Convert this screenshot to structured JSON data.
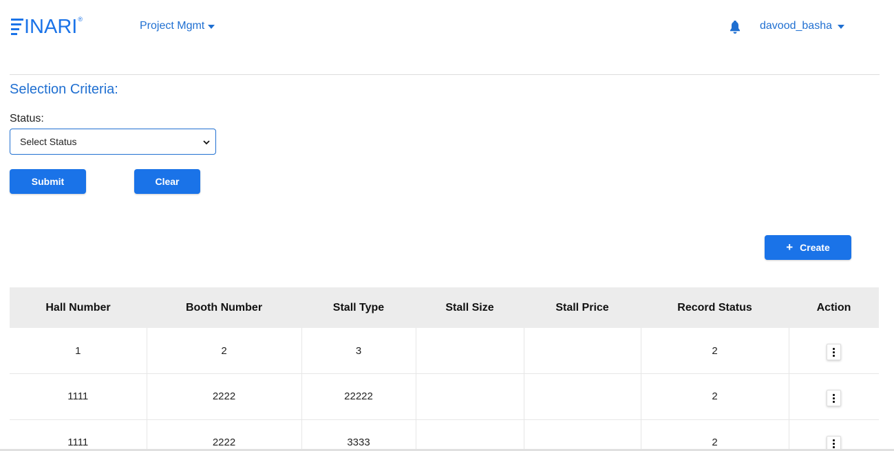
{
  "brand": {
    "logo_text": "INARI",
    "logo_mark": "®"
  },
  "nav": {
    "menu_label": "Project Mgmt",
    "menu_icon": "caret-down-icon"
  },
  "user": {
    "name": "davood_basha",
    "notifications_icon": "bell-icon"
  },
  "colors": {
    "primary": "#1a73e8",
    "link": "#1f6fd1",
    "header_bg": "#ececec"
  },
  "filters": {
    "title": "Selection Criteria:",
    "status_label": "Status:",
    "status_value": "Select Status",
    "submit_label": "Submit",
    "clear_label": "Clear"
  },
  "actions": {
    "create_label": "Create",
    "create_icon": "plus-icon"
  },
  "table": {
    "columns": [
      "Hall Number",
      "Booth Number",
      "Stall Type",
      "Stall Size",
      "Stall Price",
      "Record Status",
      "Action"
    ],
    "rows": [
      [
        "1",
        "2",
        "3",
        "",
        "",
        "2"
      ],
      [
        "1111",
        "2222",
        "22222",
        "",
        "",
        "2"
      ],
      [
        "1111",
        "2222",
        "3333",
        "",
        "",
        "2"
      ]
    ],
    "action_icon": "kebab-menu-icon"
  }
}
